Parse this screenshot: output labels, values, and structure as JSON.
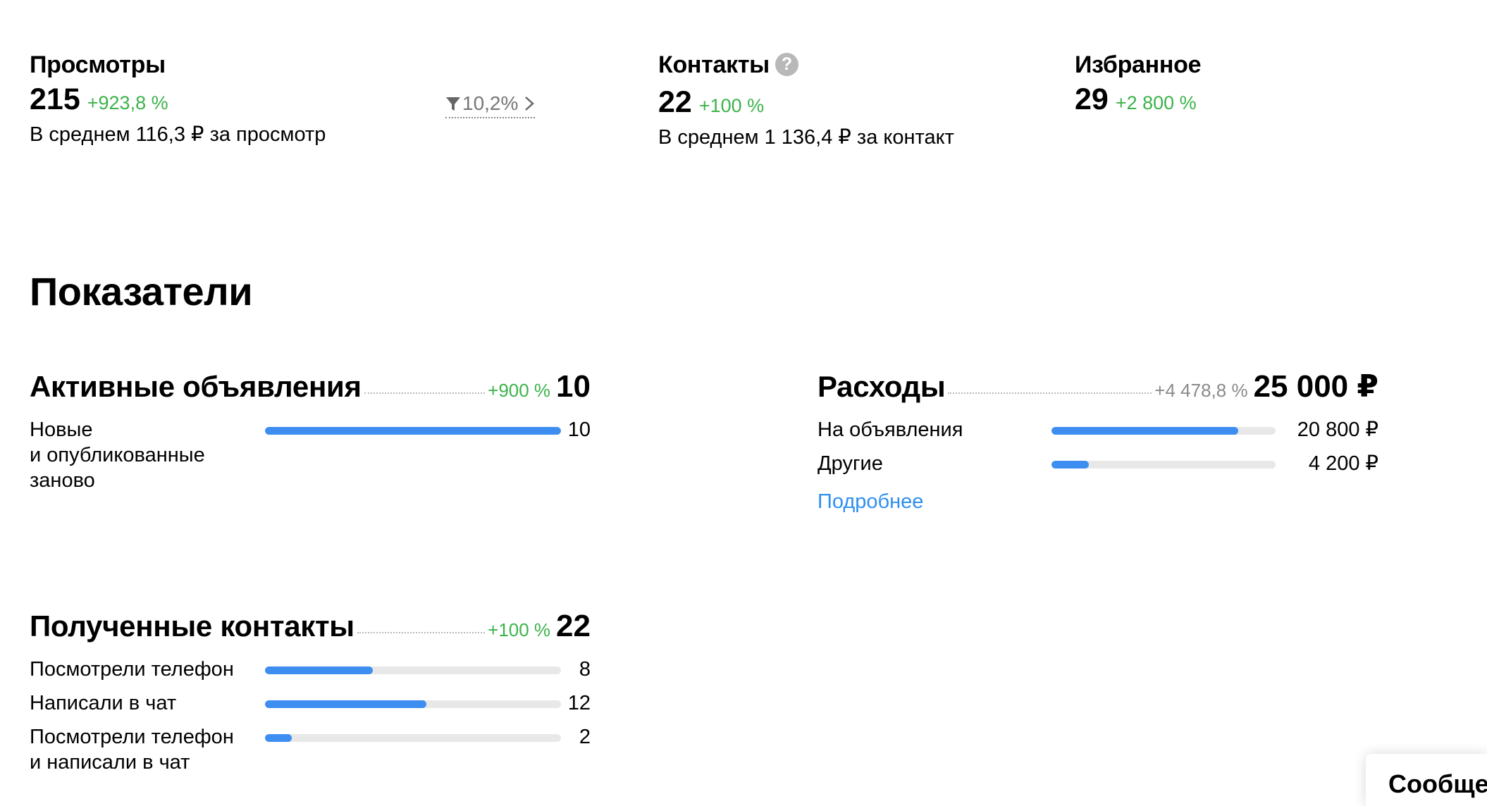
{
  "stats": {
    "views": {
      "title": "Просмотры",
      "value": "215",
      "change": "+923,8 %",
      "subtitle": "В среднем 116,3 ₽ за просмотр",
      "conversion": "10,2%"
    },
    "contacts": {
      "title": "Контакты",
      "help": "?",
      "value": "22",
      "change": "+100 %",
      "subtitle": "В среднем 1 136,4 ₽ за контакт"
    },
    "favorites": {
      "title": "Избранное",
      "value": "29",
      "change": "+2 800 %"
    }
  },
  "indicators": {
    "title": "Показатели",
    "active_ads": {
      "title": "Активные объявления",
      "change": "+900 %",
      "value": "10",
      "rows": [
        {
          "label_lines": [
            "Новые",
            "и опубликованные",
            "заново"
          ],
          "value": "10",
          "fraction": 1.0
        }
      ]
    },
    "expenses": {
      "title": "Расходы",
      "change": "+4 478,8 %",
      "value": "25 000 ₽",
      "rows": [
        {
          "label": "На объявления",
          "value": "20 800 ₽",
          "fraction": 0.832
        },
        {
          "label": "Другие",
          "value": "4 200 ₽",
          "fraction": 0.168
        }
      ],
      "more_link": "Подробнее"
    },
    "received_contacts": {
      "title": "Полученные контакты",
      "change": "+100 %",
      "value": "22",
      "rows": [
        {
          "label_lines": [
            "Посмотрели телефон"
          ],
          "value": "8",
          "fraction": 0.364
        },
        {
          "label_lines": [
            "Написали в чат"
          ],
          "value": "12",
          "fraction": 0.545
        },
        {
          "label_lines": [
            "Посмотрели телефон",
            "и написали в чат"
          ],
          "value": "2",
          "fraction": 0.091
        }
      ]
    }
  },
  "messages": {
    "label": "Сообщения"
  },
  "colors": {
    "positive": "#3cb34a",
    "bar": "#3d8ef0",
    "link": "#2f8ff0"
  }
}
